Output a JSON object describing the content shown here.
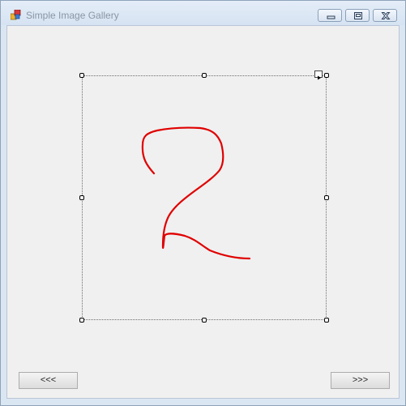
{
  "window": {
    "title": "Simple Image Gallery",
    "icon": "app-window-icon",
    "caption_buttons": [
      "minimize-icon",
      "maximize-icon",
      "close-icon"
    ]
  },
  "designer": {
    "selected_control": "picture-box",
    "smart_tag_icon": "smart-tag-arrow-icon"
  },
  "picture": {
    "content": "handwritten red digit drawing",
    "stroke_color": "#e00000"
  },
  "navigation": {
    "prev_label": "<<<",
    "next_label": ">>>"
  },
  "colors": {
    "client_background": "#f0f0f0",
    "title_text": "#8a96a4",
    "selection_border": "#6e6e6e"
  }
}
